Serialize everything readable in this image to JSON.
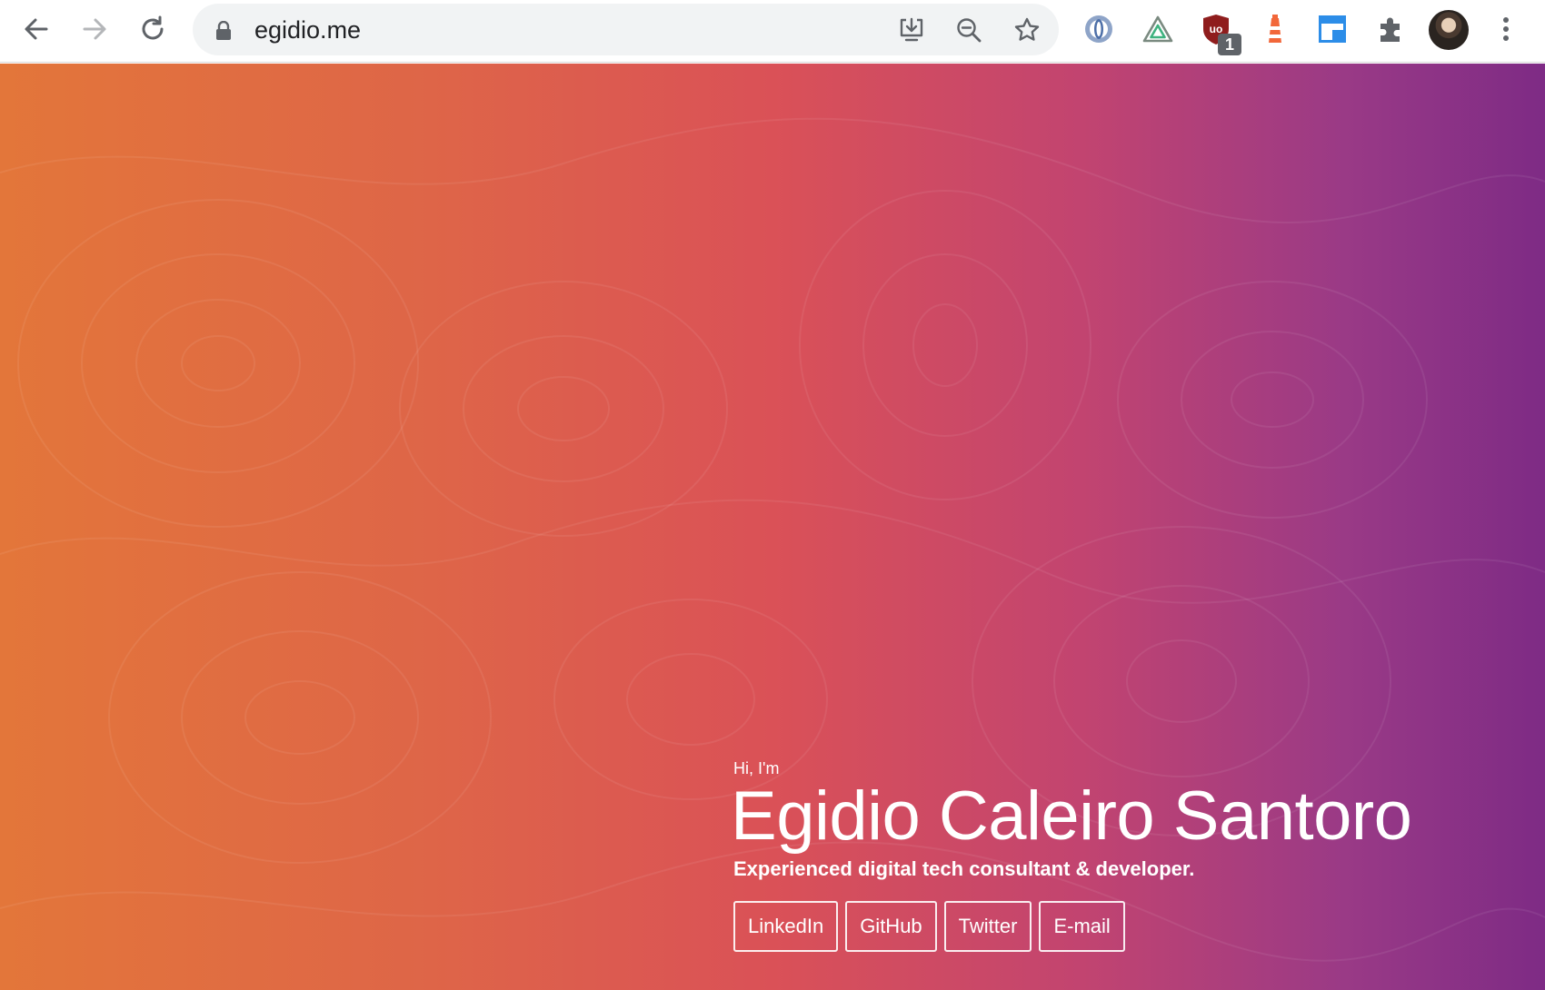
{
  "browser": {
    "url": "egidio.me",
    "extension_badge": "1"
  },
  "hero": {
    "greeting": "Hi, I'm",
    "name": "Egidio Caleiro Santoro",
    "tagline": "Experienced digital tech consultant & developer.",
    "links": [
      {
        "label": "LinkedIn"
      },
      {
        "label": "GitHub"
      },
      {
        "label": "Twitter"
      },
      {
        "label": "E-mail"
      }
    ]
  },
  "colors": {
    "gradient_start": "#e3763a",
    "gradient_mid": "#da5157",
    "gradient_end": "#7e2b85"
  }
}
